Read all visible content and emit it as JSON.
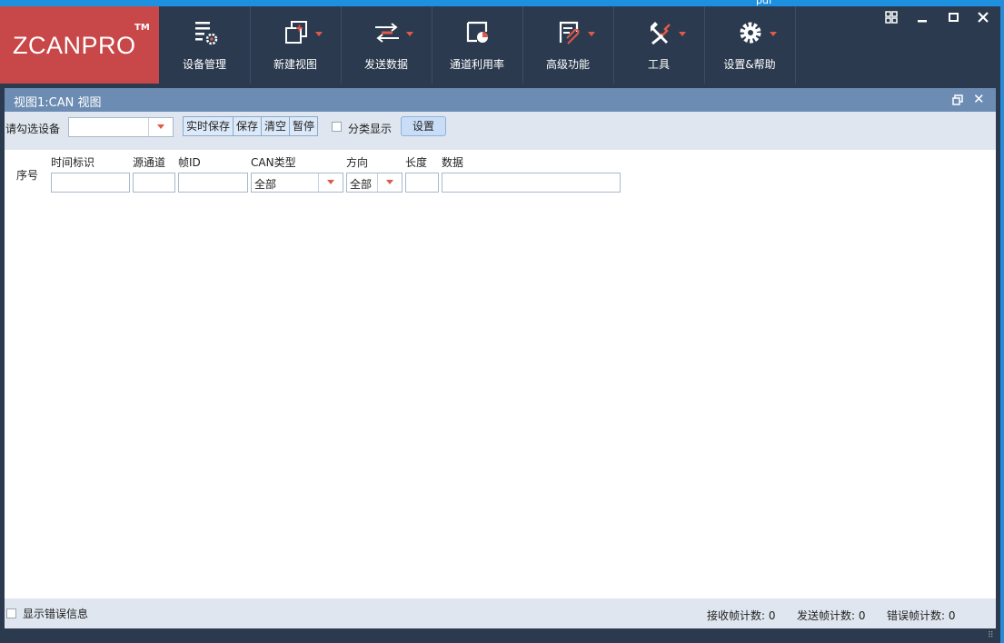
{
  "desktop": {
    "label": "pdf"
  },
  "app": {
    "logo": {
      "text": "ZCANPRO",
      "tm": "TM"
    },
    "ribbon": [
      {
        "label": "设备管理",
        "icon": "device-list-gear-icon",
        "has_dropdown": false
      },
      {
        "label": "新建视图",
        "icon": "new-view-icon",
        "has_dropdown": true
      },
      {
        "label": "发送数据",
        "icon": "send-arrows-icon",
        "has_dropdown": true
      },
      {
        "label": "通道利用率",
        "icon": "channel-usage-icon",
        "has_dropdown": false
      },
      {
        "label": "高级功能",
        "icon": "advanced-feature-icon",
        "has_dropdown": true
      },
      {
        "label": "工具",
        "icon": "tools-icon",
        "has_dropdown": true
      },
      {
        "label": "设置&帮助",
        "icon": "settings-gear-icon",
        "has_dropdown": true
      }
    ],
    "colors": {
      "accent": "#c8484a",
      "ribbon_bg": "#2b3a4e",
      "panel_title": "#6d8cb3",
      "dropdown_caret": "#e05a4a"
    }
  },
  "view": {
    "title": "视图1:CAN 视图",
    "toolbar": {
      "device_label": "请勾选设备",
      "device_value": "",
      "buttons": [
        "实时保存",
        "保存",
        "清空",
        "暂停"
      ],
      "classify_label": "分类显示",
      "settings_label": "设置"
    },
    "table": {
      "headers": {
        "index": "序号",
        "timestamp": "时间标识",
        "source_channel": "源通道",
        "frame_id": "帧ID",
        "can_type": "CAN类型",
        "direction": "方向",
        "length": "长度",
        "data": "数据"
      },
      "filters": {
        "can_type": "全部",
        "direction": "全部"
      }
    },
    "status": {
      "show_errors": "显示错误信息",
      "rx_count": "接收帧计数: 0",
      "tx_count": "发送帧计数: 0",
      "err_count": "错误帧计数: 0"
    }
  }
}
